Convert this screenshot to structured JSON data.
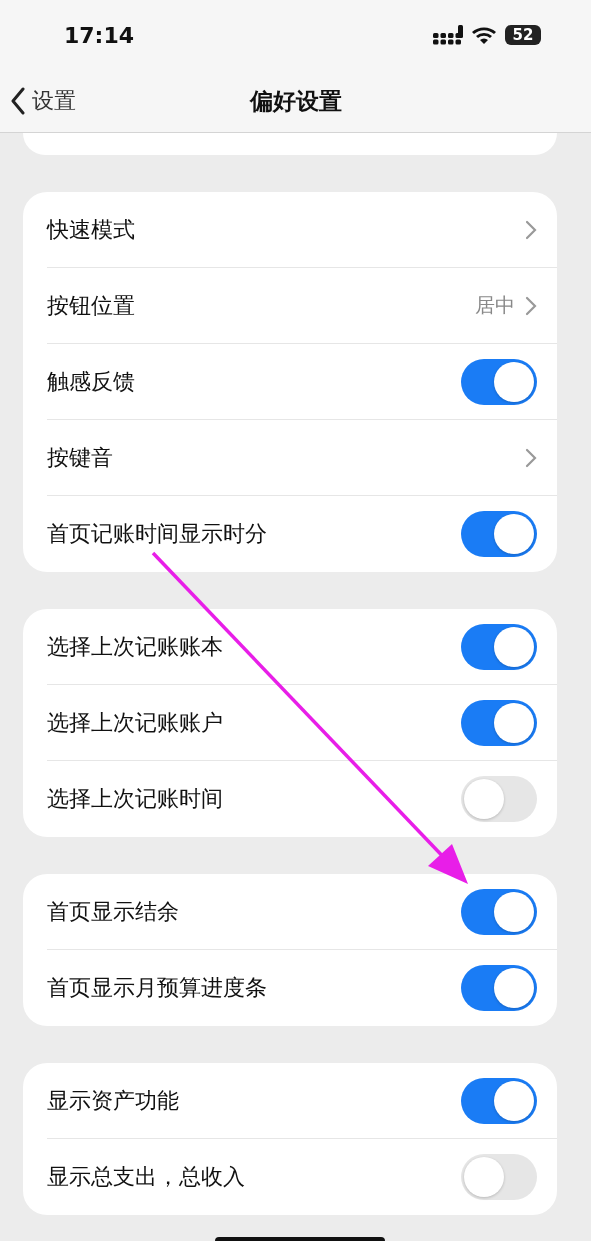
{
  "status_bar": {
    "time": "17:14",
    "battery": "52"
  },
  "nav": {
    "back": "设置",
    "title": "偏好设置"
  },
  "groups": [
    {
      "rows": [
        {
          "kind": "chevron",
          "label": "快速模式"
        },
        {
          "kind": "chevron",
          "label": "按钮位置",
          "value": "居中"
        },
        {
          "kind": "toggle",
          "label": "触感反馈",
          "on": true
        },
        {
          "kind": "chevron",
          "label": "按键音"
        },
        {
          "kind": "toggle",
          "label": "首页记账时间显示时分",
          "on": true
        }
      ]
    },
    {
      "rows": [
        {
          "kind": "toggle",
          "label": "选择上次记账账本",
          "on": true
        },
        {
          "kind": "toggle",
          "label": "选择上次记账账户",
          "on": true
        },
        {
          "kind": "toggle",
          "label": "选择上次记账时间",
          "on": false
        }
      ]
    },
    {
      "rows": [
        {
          "kind": "toggle",
          "label": "首页显示结余",
          "on": true
        },
        {
          "kind": "toggle",
          "label": "首页显示月预算进度条",
          "on": true
        }
      ]
    },
    {
      "rows": [
        {
          "kind": "toggle",
          "label": "显示资产功能",
          "on": true
        },
        {
          "kind": "toggle",
          "label": "显示总支出，总收入",
          "on": false
        }
      ]
    }
  ]
}
